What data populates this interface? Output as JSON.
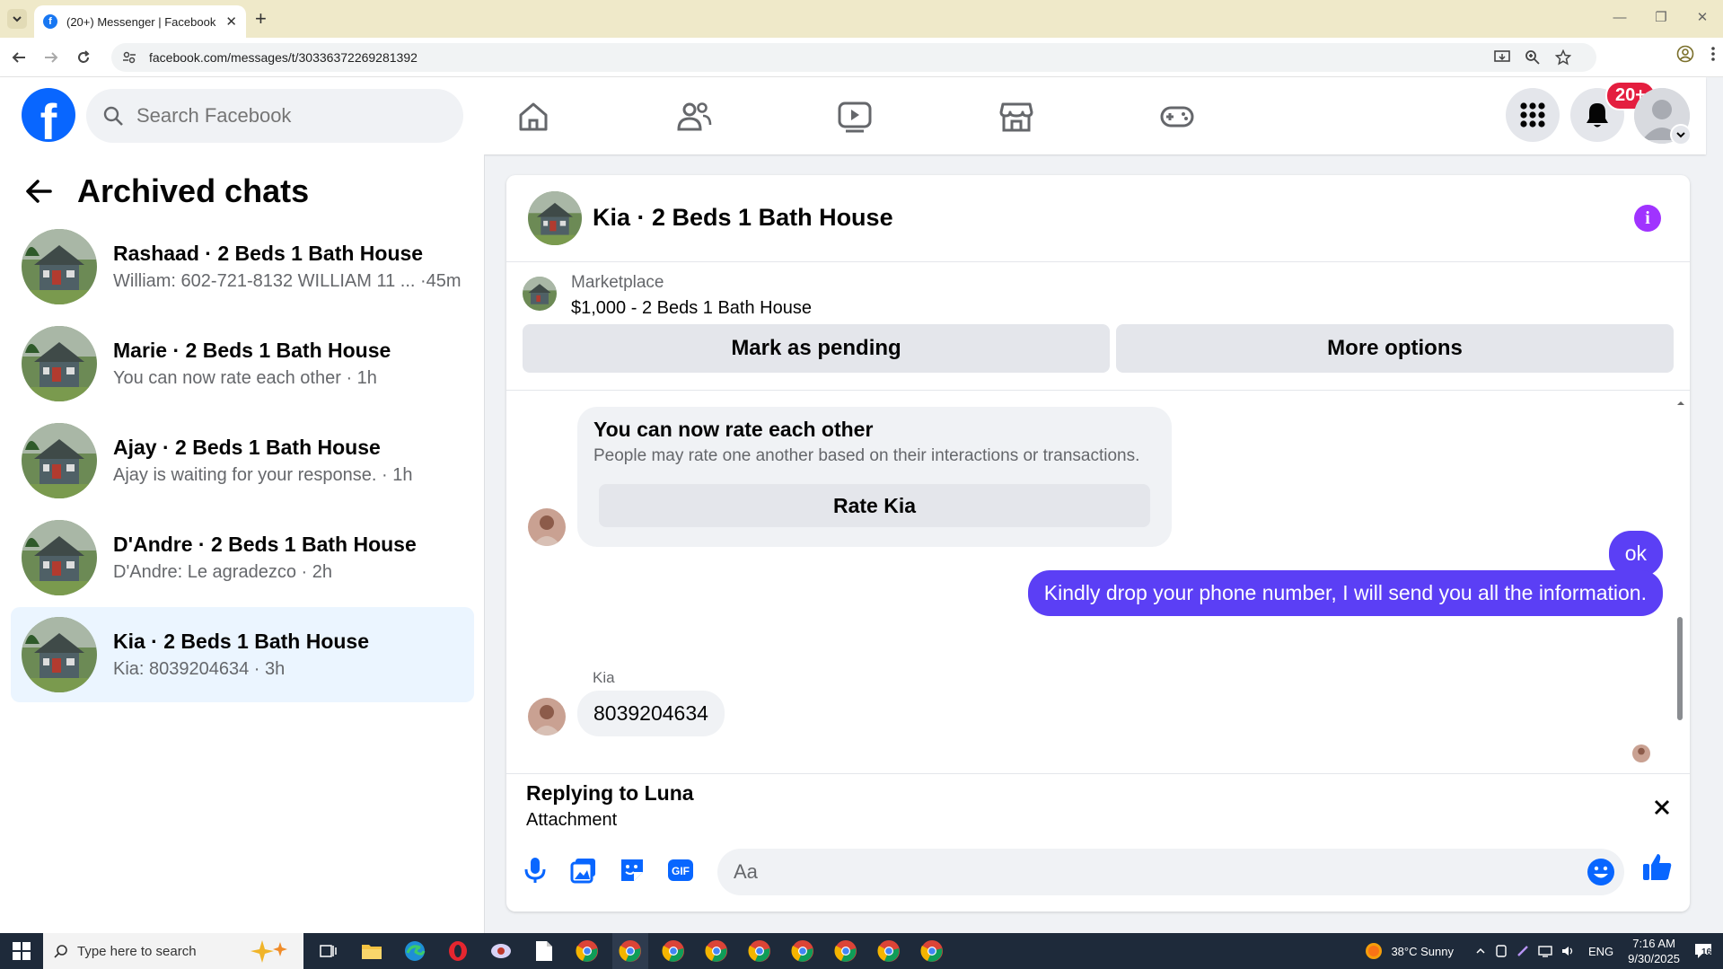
{
  "browser": {
    "tab_title": "(20+) Messenger | Facebook",
    "url": "facebook.com/messages/t/30336372269281392"
  },
  "fb": {
    "logo_letter": "f",
    "search_placeholder": "Search Facebook",
    "notification_count": "20+",
    "brand_color": "#0866ff"
  },
  "sidebar": {
    "title": "Archived chats",
    "chats": [
      {
        "name": "Rashaad · 2 Beds 1 Bath House",
        "preview": "William: 602-721-8132 WILLIAM 11 ... ·45m"
      },
      {
        "name": "Marie · 2 Beds 1 Bath House",
        "preview": "You can now rate each other · 1h"
      },
      {
        "name": "Ajay · 2 Beds 1 Bath House",
        "preview": "Ajay is waiting for your response. · 1h"
      },
      {
        "name": "D'Andre · 2 Beds 1 Bath House",
        "preview": "D'Andre: Le agradezco · 2h"
      },
      {
        "name": "Kia · 2 Beds 1 Bath House",
        "preview": "Kia: 8039204634 · 3h"
      }
    ]
  },
  "conversation": {
    "title": "Kia · 2 Beds 1 Bath House",
    "marketplace_label": "Marketplace",
    "listing": "$1,000 - 2 Beds 1 Bath House",
    "mark_pending": "Mark as pending",
    "more_options": "More options",
    "rate_card": {
      "title": "You can now rate each other",
      "desc": "People may rate one another based on their interactions or transactions.",
      "button": "Rate Kia"
    },
    "msg_ok": "ok",
    "msg_info": "Kindly drop your phone number, I will send you all the information.",
    "sender": "Kia",
    "msg_phone": "8039204634",
    "reply_title": "Replying to Luna",
    "reply_sub": "Attachment",
    "input_placeholder": "Aa",
    "accent_color": "#5b3ff5"
  },
  "taskbar": {
    "search_placeholder": "Type here to search",
    "weather": "38°C  Sunny",
    "lang": "ENG",
    "time": "7:16 AM",
    "date": "9/30/2025",
    "notif": "16"
  }
}
